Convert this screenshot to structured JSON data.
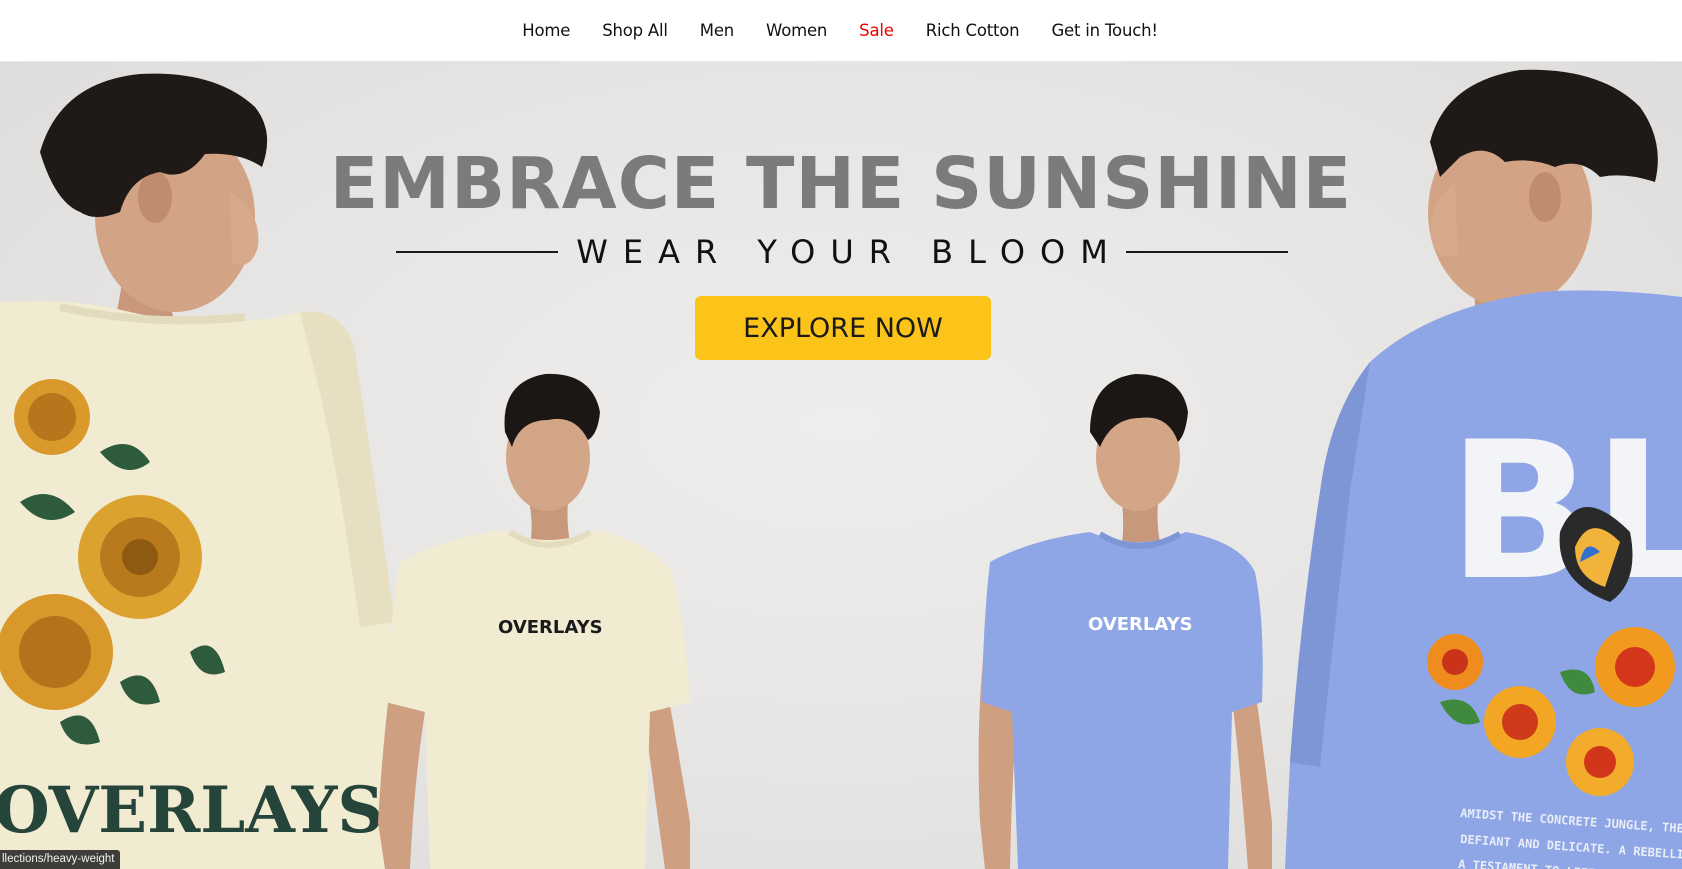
{
  "nav": {
    "items": [
      {
        "label": "Home"
      },
      {
        "label": "Shop All"
      },
      {
        "label": "Men"
      },
      {
        "label": "Women"
      },
      {
        "label": "Sale"
      },
      {
        "label": "Rich Cotton"
      },
      {
        "label": "Get in Touch!"
      }
    ],
    "sale_color": "#f00000"
  },
  "hero": {
    "headline": "EMBRACE THE SUNSHINE",
    "subline": "WEAR YOUR BLOOM",
    "cta_label": "EXPLORE NOW",
    "cta_color": "#fcc419",
    "shirts": {
      "cream_back_print": "OVERLAYS",
      "cream_front_logo": "OVERLAYS",
      "blue_front_logo": "OVERLAYS",
      "blue_back_print": "BLO",
      "blue_back_text_lines": [
        "AMIDST THE CONCRETE JUNGLE, THE FLOW",
        "DEFIANT AND DELICATE. A REBELLION AGAINST",
        "A TESTAMENT TO LIFE'S IRREPRESSIBLE U"
      ]
    }
  },
  "status": {
    "url_hint": "llections/heavy-weight"
  },
  "colors": {
    "headline": "#7b7b7b",
    "cream_shirt": "#f1ebd2",
    "blue_shirt": "#8ea6e6"
  }
}
